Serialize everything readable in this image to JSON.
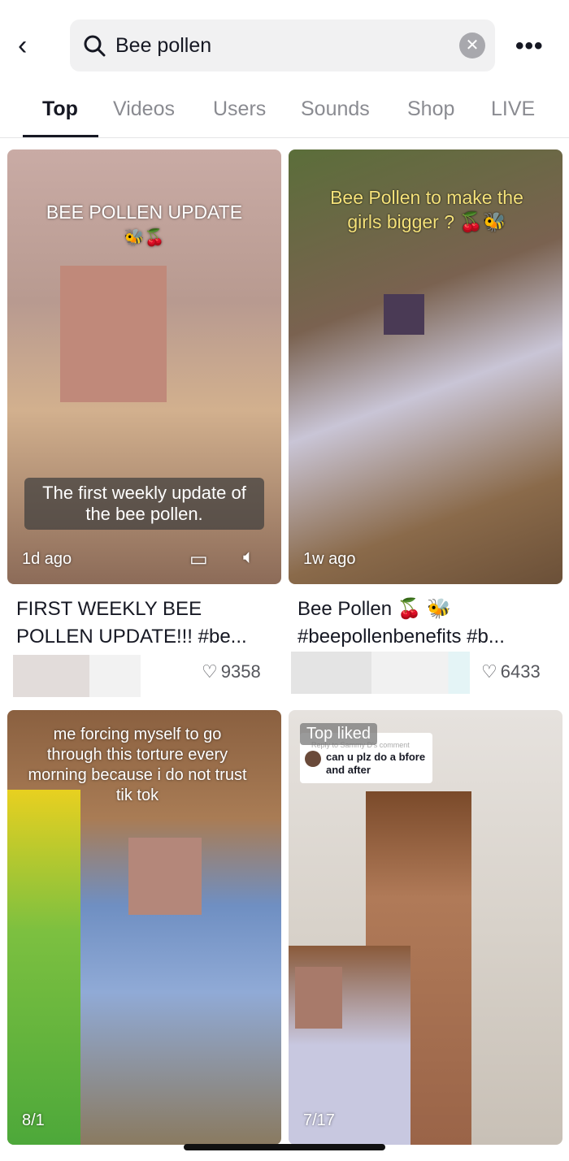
{
  "search": {
    "value": "Bee pollen"
  },
  "tabs": [
    "Top",
    "Videos",
    "Users",
    "Sounds",
    "Shop",
    "LIVE"
  ],
  "results": [
    {
      "overlay_title": "BEE POLLEN UPDATE",
      "overlay_emoji": "🐝🍒",
      "subtitle": "The first weekly update of the bee pollen.",
      "age": "1d ago",
      "caption": "FIRST WEEKLY BEE POLLEN UPDATE!!! #be...",
      "likes": "9358"
    },
    {
      "overlay_title": "Bee Pollen to make the girls bigger ? 🍒🐝",
      "age": "1w ago",
      "caption": "Bee Pollen 🍒 🐝 #beepollenbenefits #b...",
      "likes": "6433"
    },
    {
      "overlay_title": "me forcing myself to go through this torture every morning because i do not trust tik tok",
      "age": "8/1"
    },
    {
      "badge": "Top liked",
      "reply_label": "Reply to Sammy D's comment",
      "comment": "can u plz do a bfore and after",
      "age": "7/17"
    }
  ]
}
